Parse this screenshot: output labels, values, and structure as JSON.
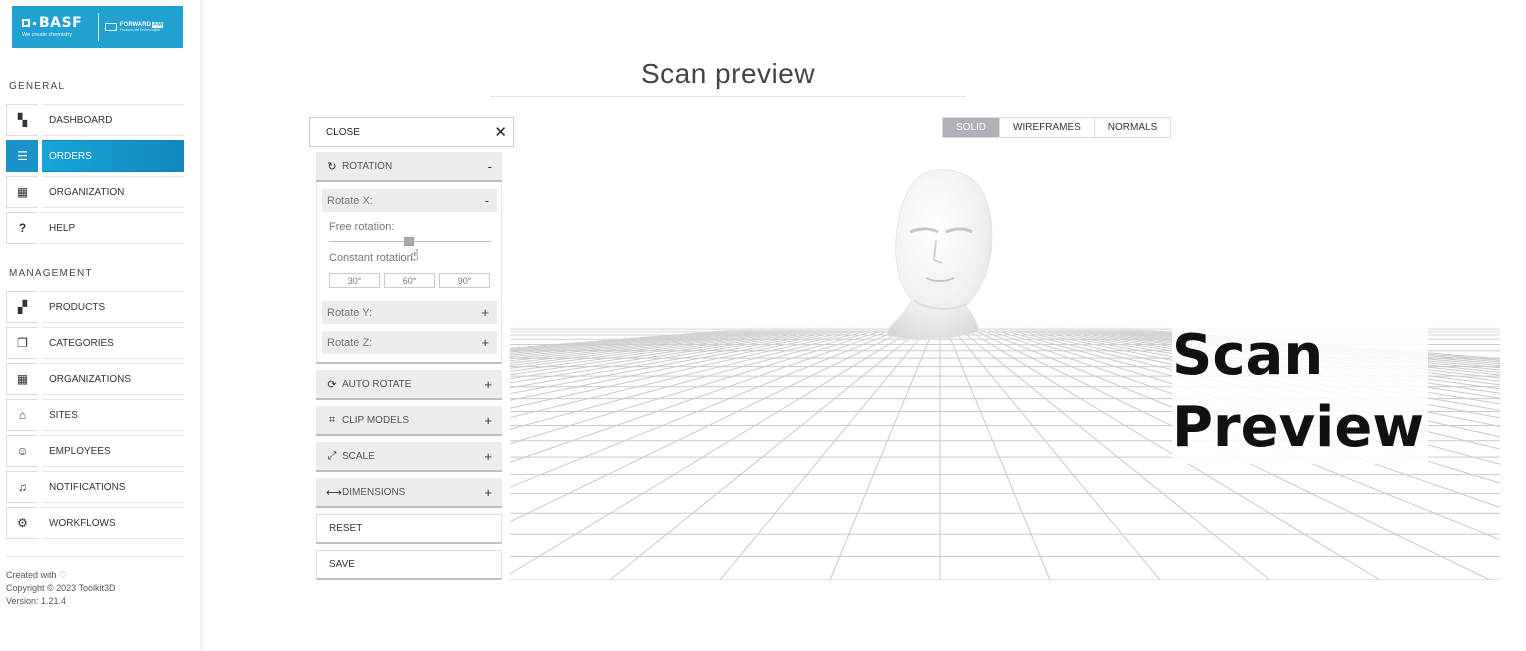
{
  "brand": {
    "name": "BASF",
    "tagline": "We create chemistry",
    "partner": "FORWARD",
    "partner_badge": "AM",
    "partner_sub": "Forward AM Technologies"
  },
  "sidebar": {
    "general_title": "GENERAL",
    "general": [
      {
        "label": "DASHBOARD",
        "icon": "dashboard-icon",
        "glyph": "▚"
      },
      {
        "label": "ORDERS",
        "icon": "orders-icon",
        "glyph": "☰",
        "active": true
      },
      {
        "label": "ORGANIZATION",
        "icon": "building-icon",
        "glyph": "▦"
      },
      {
        "label": "HELP",
        "icon": "help-icon",
        "glyph": "?"
      }
    ],
    "management_title": "MANAGEMENT",
    "management": [
      {
        "label": "PRODUCTS",
        "icon": "boxes-icon",
        "glyph": "▞"
      },
      {
        "label": "CATEGORIES",
        "icon": "bookmark-icon",
        "glyph": "❐"
      },
      {
        "label": "ORGANIZATIONS",
        "icon": "building-icon",
        "glyph": "▦"
      },
      {
        "label": "SITES",
        "icon": "store-icon",
        "glyph": "⌂"
      },
      {
        "label": "EMPLOYEES",
        "icon": "users-icon",
        "glyph": "☺"
      },
      {
        "label": "NOTIFICATIONS",
        "icon": "bell-icon",
        "glyph": "♫"
      },
      {
        "label": "WORKFLOWS",
        "icon": "cogs-icon",
        "glyph": "⚙"
      }
    ],
    "footer": {
      "created_with": "Created with",
      "copyright": "Copyright © 2023 Toolkit3D",
      "version": "Version: 1.21.4"
    }
  },
  "main": {
    "title": "Scan preview",
    "view_modes": [
      {
        "label": "SOLID",
        "active": true
      },
      {
        "label": "WIREFRAMES",
        "active": false
      },
      {
        "label": "NORMALS",
        "active": false
      }
    ],
    "overlay_line1": "Scan",
    "overlay_line2": "Preview"
  },
  "panel": {
    "close_label": "CLOSE",
    "rotation": {
      "label": "ROTATION",
      "toggle": "-",
      "rotate_x": {
        "label": "Rotate X:",
        "toggle": "-"
      },
      "free_rotation_label": "Free rotation:",
      "free_rotation_value": 0.5,
      "constant_rotation_label": "Constant rotation:",
      "degrees": [
        "30°",
        "60°",
        "90°"
      ],
      "rotate_y": {
        "label": "Rotate Y:",
        "toggle": "+"
      },
      "rotate_z": {
        "label": "Rotate Z:",
        "toggle": "+"
      }
    },
    "sections": [
      {
        "label": "AUTO ROTATE",
        "icon": "sync-icon",
        "glyph": "⟳",
        "toggle": "+"
      },
      {
        "label": "CLIP MODELS",
        "icon": "crop-icon",
        "glyph": "⌗",
        "toggle": "+"
      },
      {
        "label": "SCALE",
        "icon": "expand-icon",
        "glyph": "⤢",
        "toggle": "+"
      },
      {
        "label": "DIMENSIONS",
        "icon": "ruler-icon",
        "glyph": "⟷",
        "toggle": "+"
      }
    ],
    "reset_label": "RESET",
    "save_label": "SAVE"
  }
}
